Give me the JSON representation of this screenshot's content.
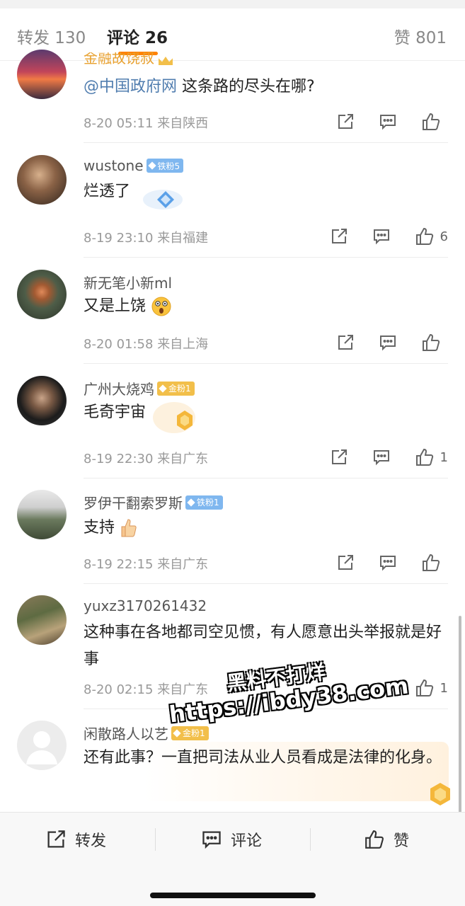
{
  "tabs": {
    "repost": "转发 130",
    "comment": "评论 26",
    "like": "赞 801"
  },
  "comments": [
    {
      "username": "金融故饶叔",
      "mention": "@中国政府网",
      "text": " 这条路的尽头在哪?",
      "time": "8-20 05:11",
      "location": "来自陕西",
      "likes": ""
    },
    {
      "username": "wustone",
      "badge": "铁粉5",
      "text": "烂透了",
      "time": "8-19 23:10",
      "location": "来自福建",
      "likes": "6"
    },
    {
      "username": "新无笔小新ml",
      "text": "又是上饶",
      "time": "8-20 01:58",
      "location": "来自上海",
      "likes": ""
    },
    {
      "username": "广州大烧鸡",
      "badge": "金粉1",
      "text": "毛奇宇宙",
      "time": "8-19 22:30",
      "location": "来自广东",
      "likes": "1"
    },
    {
      "username": "罗伊干翻索罗斯",
      "badge": "铁粉1",
      "text": "支持",
      "time": "8-19 22:15",
      "location": "来自广东",
      "likes": ""
    },
    {
      "username": "yuxz3170261432",
      "text": "这种事在各地都司空见惯，有人愿意出头举报就是好事",
      "time": "8-20 02:15",
      "location": "来自广东",
      "likes": "1"
    },
    {
      "username": "闲散路人以艺",
      "badge": "金粉1",
      "text": "还有此事？一直把司法从业人员看成是法律的化身。"
    }
  ],
  "watermark": {
    "line1": "黑料不打烊",
    "line2": "https://ibdy38.com"
  },
  "bottom_bar": {
    "repost": "转发",
    "comment": "评论",
    "like": "赞"
  },
  "icons": {
    "share": "share-icon",
    "reply": "comment-icon",
    "like": "thumbs-up-icon"
  },
  "colors": {
    "accent": "#ff8200",
    "mention": "#507daf",
    "badge_blue": "#7fb7ef",
    "badge_gold": "#f2bf4a"
  }
}
